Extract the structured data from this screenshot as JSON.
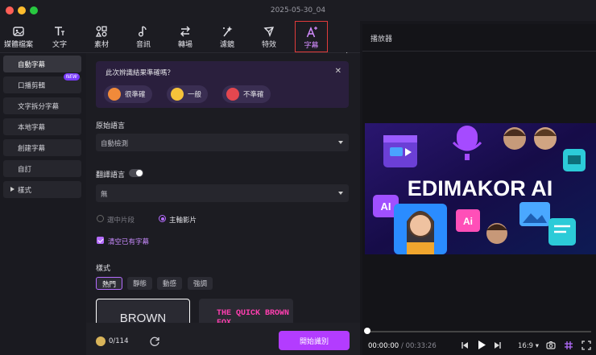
{
  "window": {
    "title": "2025-05-30_04"
  },
  "toolbar": {
    "items": [
      {
        "label": "媒體檔案",
        "icon": "media-icon"
      },
      {
        "label": "文字",
        "icon": "text-icon"
      },
      {
        "label": "素材",
        "icon": "elements-icon"
      },
      {
        "label": "音訊",
        "icon": "audio-icon"
      },
      {
        "label": "轉場",
        "icon": "transition-icon"
      },
      {
        "label": "濾鏡",
        "icon": "filter-icon"
      },
      {
        "label": "特效",
        "icon": "effects-icon"
      },
      {
        "label": "字幕",
        "icon": "subtitle-icon"
      }
    ]
  },
  "sidebar": {
    "items": [
      {
        "label": "自動字幕"
      },
      {
        "label": "口播剪輯",
        "badge": "NEW"
      },
      {
        "label": "文字拆分字幕"
      },
      {
        "label": "本地字幕"
      },
      {
        "label": "創建字幕"
      },
      {
        "label": "自訂"
      },
      {
        "label": "樣式"
      }
    ]
  },
  "feedback": {
    "question": "此次辨識結果準確嗎？",
    "options": [
      "很準確",
      "一般",
      "不準確"
    ]
  },
  "source_lang": {
    "label": "原始語言",
    "value": "自動檢測"
  },
  "translate": {
    "label": "翻譯語言",
    "value": "無"
  },
  "apply_to": {
    "options": [
      "選中片段",
      "主軸影片"
    ],
    "selected": "主軸影片"
  },
  "clear": {
    "label": "清空已有字幕",
    "checked": true
  },
  "styles": {
    "label": "樣式",
    "tabs": [
      "熱門",
      "靜態",
      "動感",
      "強調"
    ],
    "templates": [
      "BROWN",
      "THE QUICK BROWN FOX"
    ]
  },
  "bottom": {
    "credits": "0/114",
    "start_label": "開始識別"
  },
  "player": {
    "title": "播放器",
    "video_text": "EDIMAKOR AI",
    "time_current": "00:00:00",
    "time_total": "/ 00:33:26",
    "ratio": "16:9",
    "progress": 0
  },
  "colors": {
    "accent": "#b33cff",
    "highlight": "#e03b3b"
  }
}
